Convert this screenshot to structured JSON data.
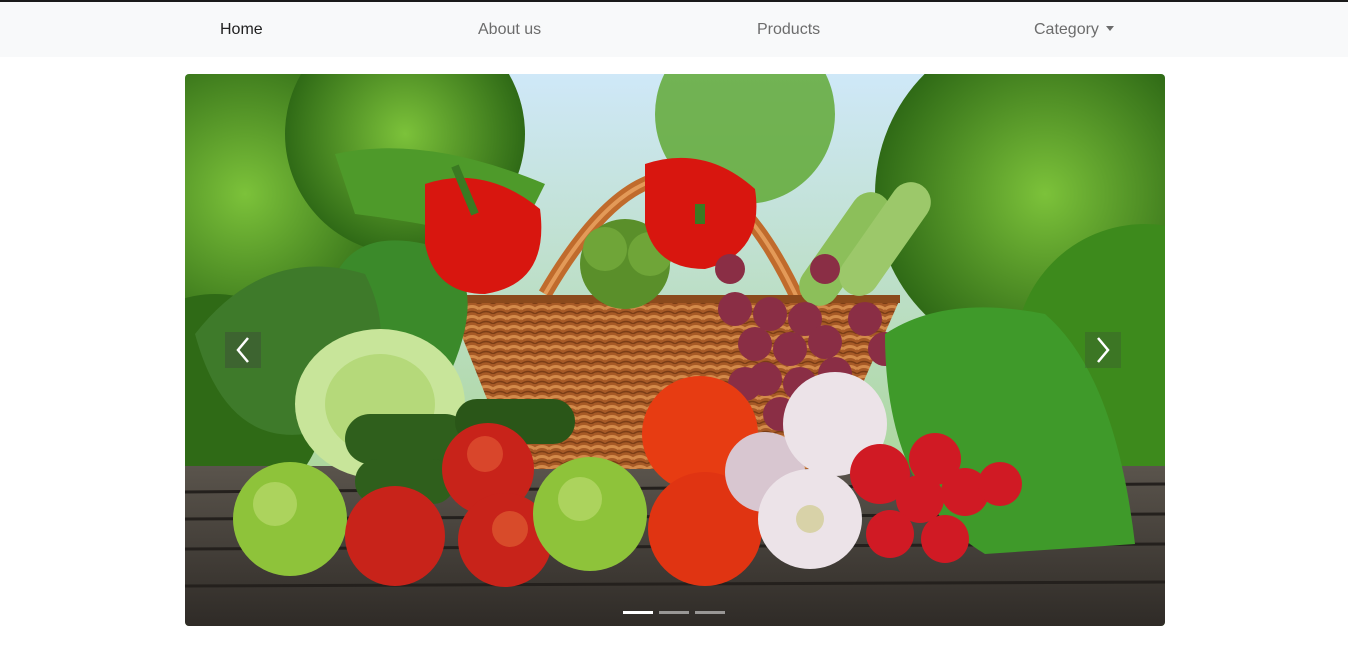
{
  "nav": {
    "home": "Home",
    "about": "About us",
    "products": "Products",
    "category": "Category"
  },
  "carousel": {
    "slide_count": 3,
    "active_slide": 1,
    "colors": {
      "sky": "#bfe0f5",
      "foliage": "#3f8c1f",
      "table": "#4a4540",
      "basket": "#b4622a",
      "pepper": "#d8160f",
      "tomato": "#e73c12",
      "apple_green": "#8ec33a",
      "apple_red": "#c8231a",
      "grape": "#8a2e45",
      "radish": "#d01a24",
      "garlic": "#ece3e8",
      "cabbage": "#c8e59a"
    },
    "icons": {
      "prev": "chevron-left-icon",
      "next": "chevron-right-icon"
    }
  }
}
